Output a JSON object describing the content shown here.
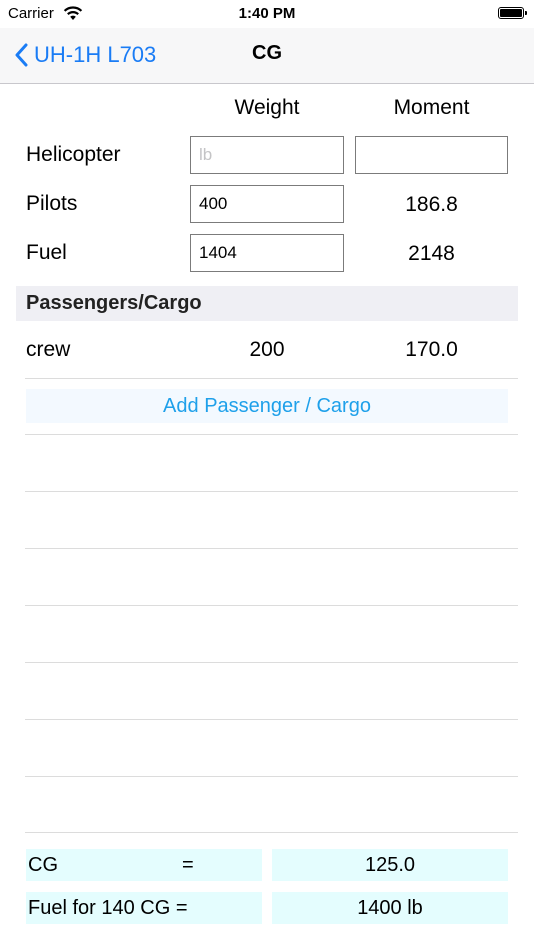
{
  "status_bar": {
    "carrier": "Carrier",
    "time": "1:40 PM"
  },
  "nav": {
    "back_label": "UH-1H L703",
    "title": "CG"
  },
  "columns": {
    "weight": "Weight",
    "moment": "Moment"
  },
  "rows": {
    "helicopter": {
      "label": "Helicopter",
      "weight_placeholder": "lb",
      "weight_value": "",
      "moment_value": ""
    },
    "pilots": {
      "label": "Pilots",
      "weight_value": "400",
      "moment": "186.8"
    },
    "fuel": {
      "label": "Fuel",
      "weight_value": "1404",
      "moment": "2148"
    }
  },
  "section": {
    "title": "Passengers/Cargo"
  },
  "passengers": [
    {
      "name": "crew",
      "weight": "200",
      "moment": "170.0"
    }
  ],
  "add_button": {
    "label": "Add Passenger / Cargo"
  },
  "results": {
    "cg_label": "CG",
    "cg_equals": "=",
    "cg_value": "125.0",
    "fuel_label": "Fuel for 140 CG =",
    "fuel_value": "1400 lb"
  },
  "colors": {
    "accent": "#1a7cf5",
    "button_text": "#1ea0ea",
    "result_bg": "#e4fdfe"
  }
}
